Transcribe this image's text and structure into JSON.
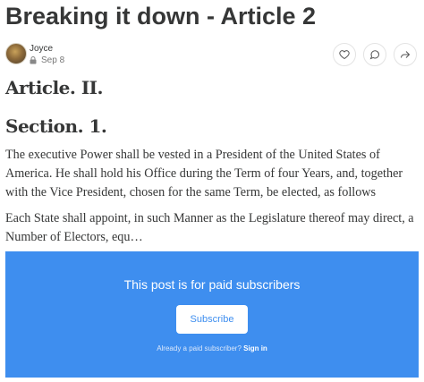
{
  "post": {
    "title": "Breaking it down - Article 2",
    "author": "Joyce",
    "date": "Sep 8"
  },
  "icons": {
    "avatar": "author-avatar",
    "lock": "lock-icon",
    "like": "heart-icon",
    "comment": "comment-icon",
    "share": "share-icon"
  },
  "content": {
    "heading": "Article. II.",
    "subheading": "Section. 1.",
    "paragraph1": "The executive Power shall be vested in a President of the United States of America. He shall hold his Office during the Term of four Years, and, together with the Vice President, chosen for the same Term, be elected, as follows",
    "paragraph2": "Each State shall appoint, in such Manner as the Legislature thereof may direct, a Number of Electors, equ…"
  },
  "paywall": {
    "title": "This post is for paid subscribers",
    "subscribe_label": "Subscribe",
    "already_text": "Already a paid subscriber?",
    "signin_label": "Sign in",
    "color": "#3e8eef"
  }
}
